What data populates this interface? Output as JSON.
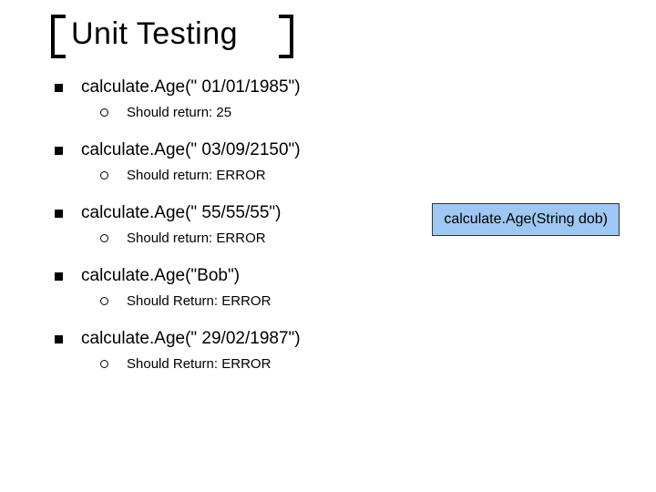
{
  "title": "Unit Testing",
  "items": [
    {
      "text": "calculate.Age(\" 01/01/1985\")",
      "sub": "Should return: 25"
    },
    {
      "text": "calculate.Age(\" 03/09/2150\")",
      "sub": "Should return: ERROR"
    },
    {
      "text": "calculate.Age(\" 55/55/55\")",
      "sub": "Should return: ERROR"
    },
    {
      "text": "calculate.Age(\"Bob\")",
      "sub": "Should Return: ERROR"
    },
    {
      "text": "calculate.Age(\" 29/02/1987\")",
      "sub": "Should Return: ERROR"
    }
  ],
  "callout": "calculate.Age(String dob)"
}
